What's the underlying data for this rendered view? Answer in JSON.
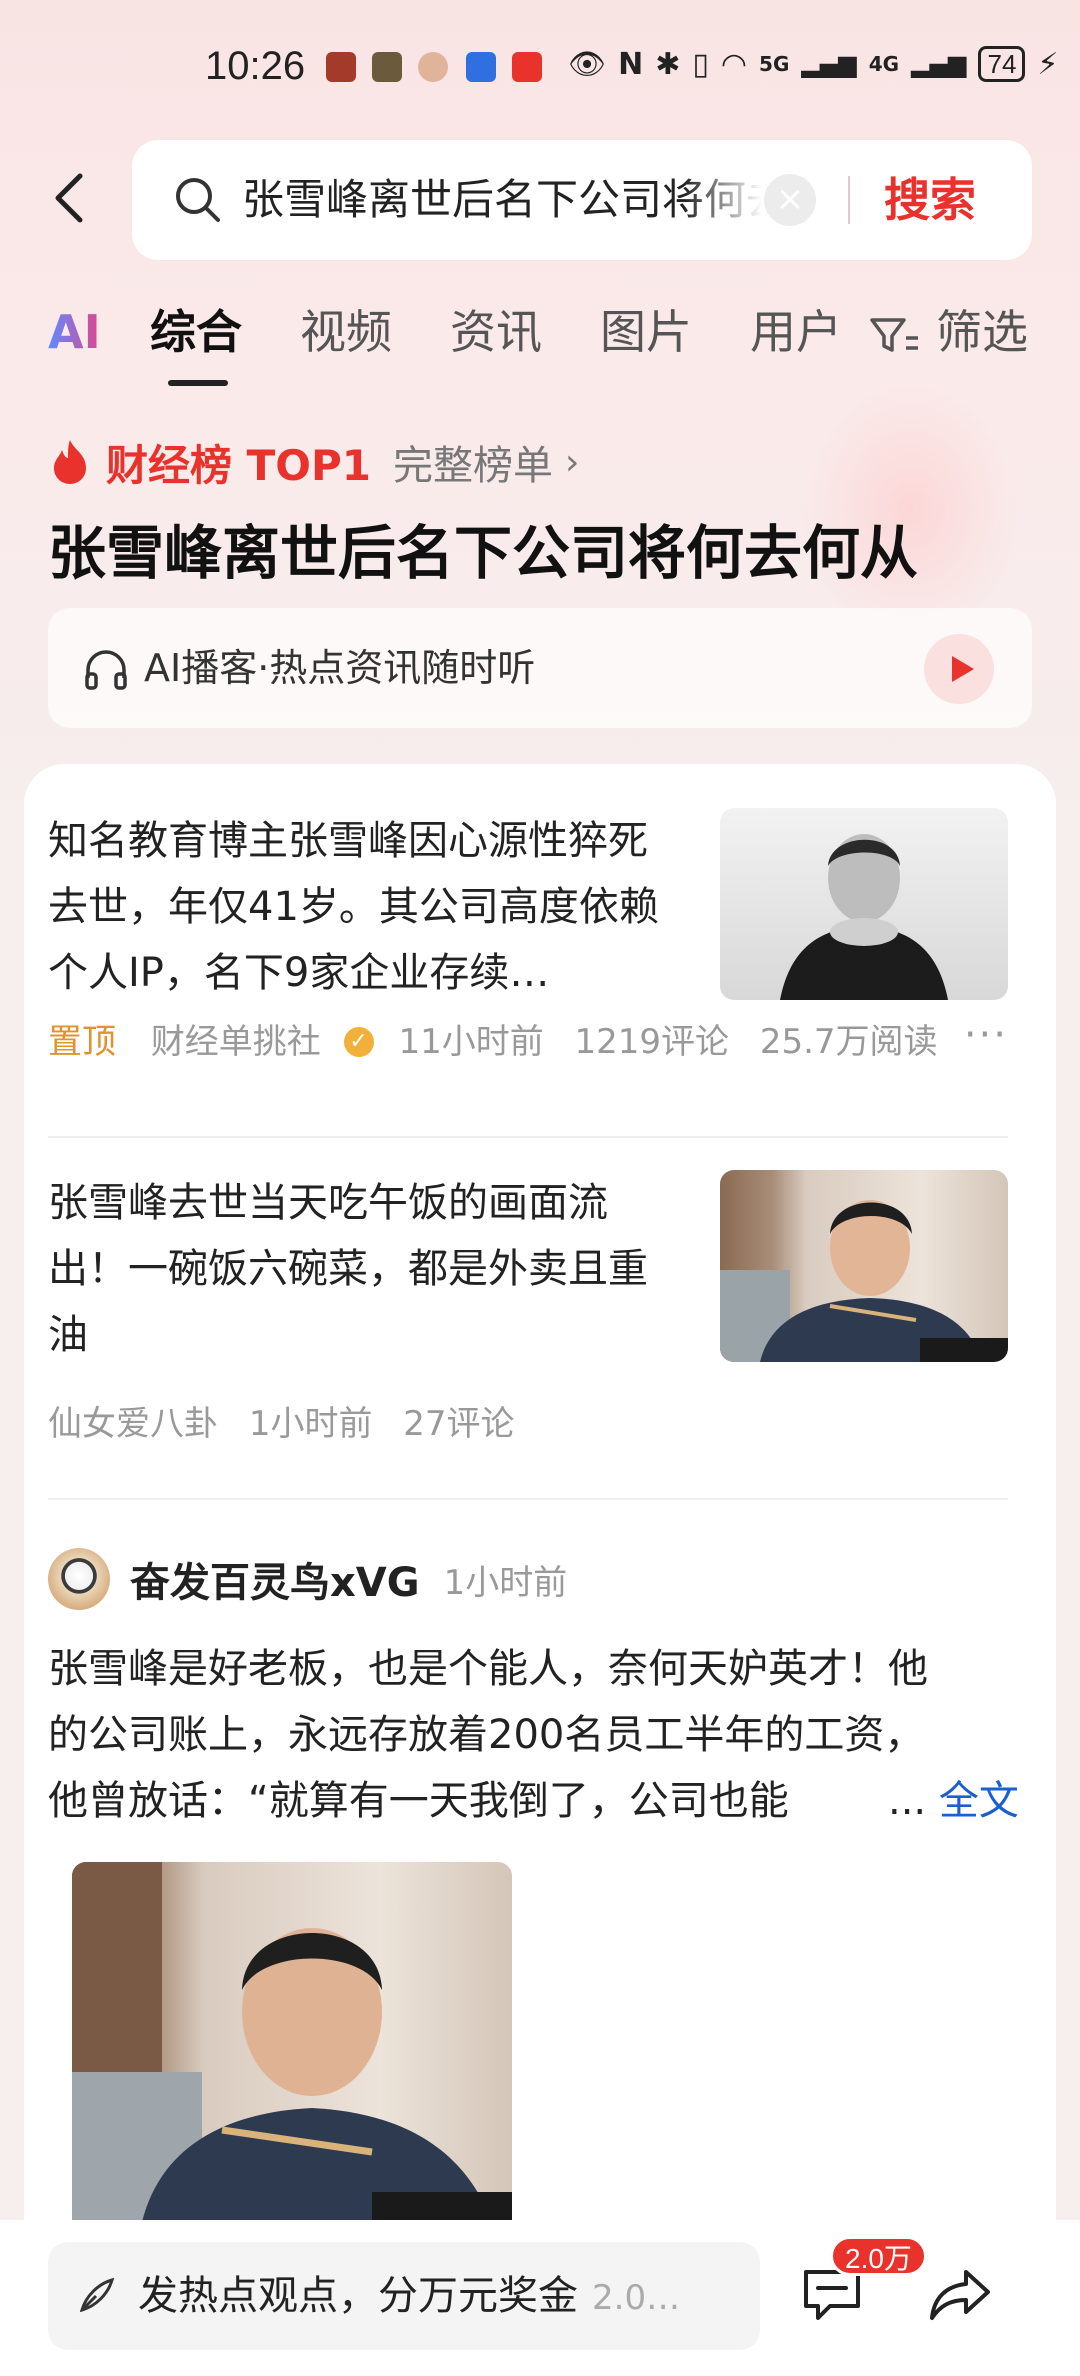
{
  "status_bar": {
    "time": "10:26",
    "network_5g": "5G",
    "network_4g": "4G",
    "battery": "74"
  },
  "search": {
    "query": "张雪峰离世后名下公司将何去何从",
    "button": "搜索"
  },
  "tabs": [
    {
      "label": "AI"
    },
    {
      "label": "综合"
    },
    {
      "label": "视频"
    },
    {
      "label": "资讯"
    },
    {
      "label": "图片"
    },
    {
      "label": "用户"
    }
  ],
  "filter_label": "筛选",
  "hot_rank": {
    "title": "财经榜 TOP1",
    "full_list": "完整榜单",
    "headline": "张雪峰离世后名下公司将何去何从"
  },
  "podcast": {
    "text": "AI播客·热点资讯随时听"
  },
  "articles": [
    {
      "title": "知名教育博主张雪峰因心源性猝死去世，年仅41岁。其公司高度依赖个人IP，名下9家企业存续…",
      "pinned": "置顶",
      "source": "财经单挑社",
      "time": "11小时前",
      "comments": "1219评论",
      "reads": "25.7万阅读"
    },
    {
      "title": "张雪峰去世当天吃午饭的画面流出！一碗饭六碗菜，都是外卖且重油",
      "source": "仙女爱八卦",
      "time": "1小时前",
      "comments": "27评论"
    }
  ],
  "post": {
    "author": "奋发百灵鸟xVG",
    "time": "1小时前",
    "lines": [
      "张雪峰是好老板，也是个能人，奈何天妒英才！他",
      "的公司账上，永远存放着200名员工半年的工资，",
      "他曾放话：“就算有一天我倒了，公司也能"
    ],
    "ellipsis": "...",
    "read_more": "全文"
  },
  "bottom_bar": {
    "comment_prompt": "发热点观点，分万元奖金",
    "comment_count_inline": "2.0…",
    "comment_badge": "2.0万"
  },
  "colors": {
    "accent_red": "#e8322b",
    "pin_orange": "#e0922c",
    "link_blue": "#1a5fd0"
  }
}
